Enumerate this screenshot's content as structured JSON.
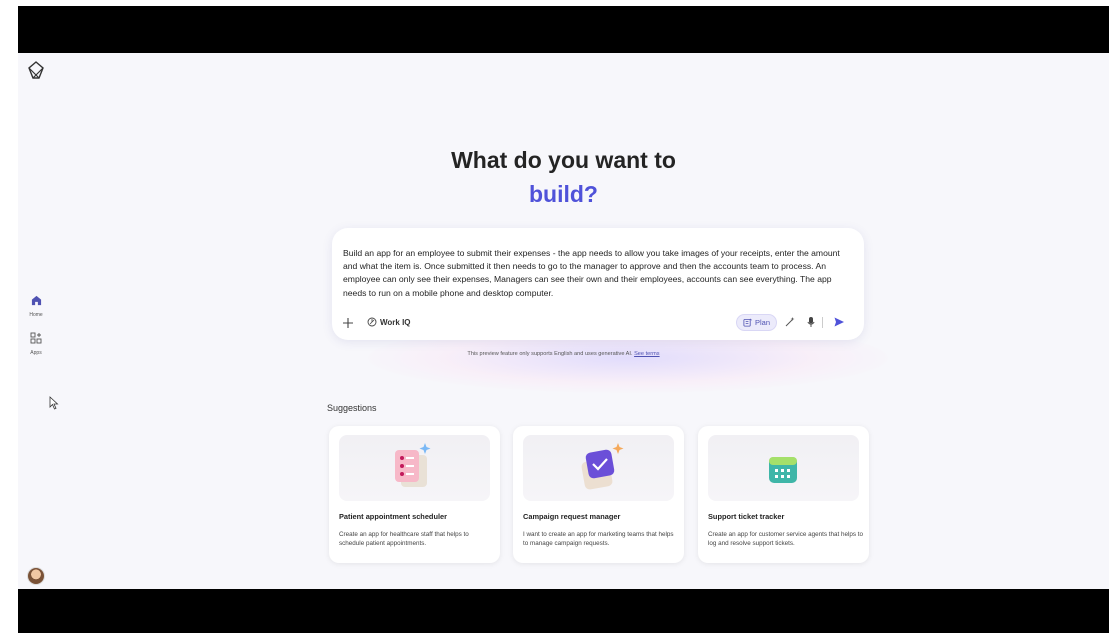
{
  "nav": {
    "home_label": "Home",
    "apps_label": "Apps"
  },
  "hero": {
    "line1": "What do you want to",
    "line2": "build?"
  },
  "prompt": {
    "text": "Build an app for an employee to submit their expenses - the app needs to allow you take images of your receipts, enter the amount and what the item is. Once submitted it then needs to go to the manager to approve and then the accounts team to process. An employee can only see their expenses, Managers can see their own and their employees, accounts can see everything. The app needs to run on a mobile phone and desktop computer.",
    "add_icon": "plus-icon",
    "work_iq_label": "Work IQ",
    "plan_label": "Plan",
    "send_icon": "send-icon",
    "mic_icon": "mic-icon",
    "wand_icon": "wand-icon"
  },
  "disclaimer": {
    "text": "This preview feature only supports English and uses generative AI.",
    "link": "See terms"
  },
  "suggestions": {
    "title": "Suggestions",
    "cards": [
      {
        "title": "Patient appointment scheduler",
        "desc": "Create an app for healthcare staff that helps to schedule patient appointments."
      },
      {
        "title": "Campaign request manager",
        "desc": "I want to create an app for marketing teams that helps to manage campaign requests."
      },
      {
        "title": "Support ticket tracker",
        "desc": "Create an app for customer service agents that helps to log and resolve support tickets."
      }
    ]
  },
  "colors": {
    "accent": "#4f52d9",
    "background": "#f7f7fb"
  }
}
